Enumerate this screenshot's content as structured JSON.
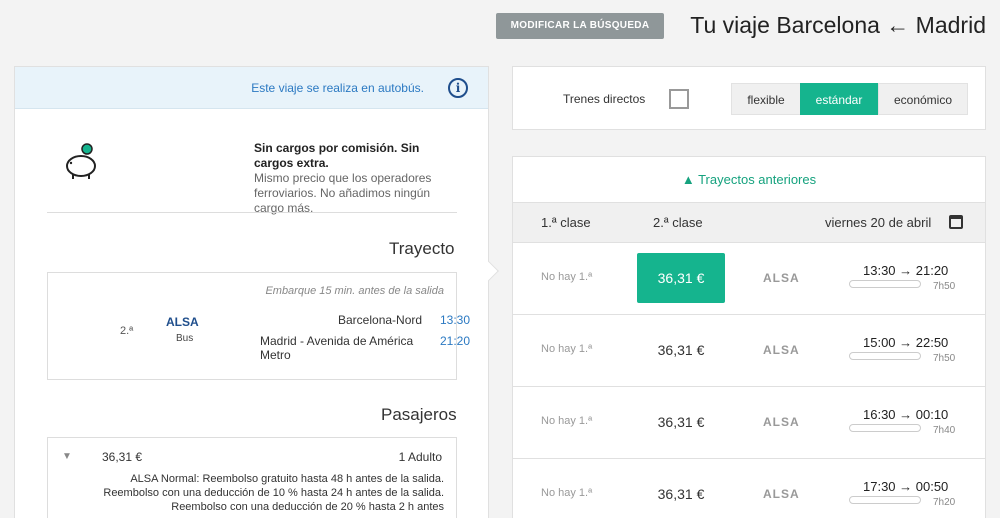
{
  "header": {
    "title": "Tu viaje Barcelona ← Madrid",
    "modify_button": "MODIFICAR LA BÚSQUEDA"
  },
  "info": {
    "text": "Este viaje se realiza en autobús.",
    "icon": "info-icon"
  },
  "promo": {
    "title": "Sin cargos por comisión. Sin cargos extra.",
    "body": "Mismo precio que los operadores ferroviarios. No añadimos ningún cargo más.",
    "icon": "piggy-bank-icon"
  },
  "trayecto": {
    "title": "Trayecto",
    "boarding": "Embarque 15 min. antes de la salida",
    "dep_time": "13:30",
    "dep_station": "Barcelona-Nord",
    "arr_time": "21:20",
    "arr_station": "Madrid - Avenida de América Metro",
    "operator": "ALSA",
    "vehicle": "Bus",
    "class": "2.ª"
  },
  "pasajeros": {
    "title": "Pasajeros",
    "adult": "1 Adulto",
    "price": "36,31 €",
    "desc": "ALSA Normal: Reembolso gratuito hasta 48 h antes de la salida. Reembolso con una deducción de 10 % hasta 24 h antes de la salida. Reembolso con una deducción de 20 % hasta 2 h antes"
  },
  "filters": {
    "checkbox_label": "Trenes directos",
    "checked": false,
    "tabs": [
      "flexible",
      "estándar",
      "económico"
    ],
    "active_tab": "estándar",
    "accent": "#15b48e"
  },
  "results": {
    "prev_trips": "▲ Trayectos anteriores",
    "date": "viernes 20 de abril",
    "class2": "2.ª clase",
    "class1": "1.ª clase",
    "rows": [
      {
        "time": "13:30 → 21:20",
        "duration": "7h50",
        "operator": "ALSA",
        "price2": "36,31 €",
        "class1": "No hay 1.ª",
        "selected": true
      },
      {
        "time": "15:00 → 22:50",
        "duration": "7h50",
        "operator": "ALSA",
        "price2": "36,31 €",
        "class1": "No hay 1.ª",
        "selected": false
      },
      {
        "time": "16:30 → 00:10",
        "duration": "7h40",
        "operator": "ALSA",
        "price2": "36,31 €",
        "class1": "No hay 1.ª",
        "selected": false
      },
      {
        "time": "17:30 → 00:50",
        "duration": "7h20",
        "operator": "ALSA",
        "price2": "36,31 €",
        "class1": "No hay 1.ª",
        "selected": false
      }
    ]
  }
}
